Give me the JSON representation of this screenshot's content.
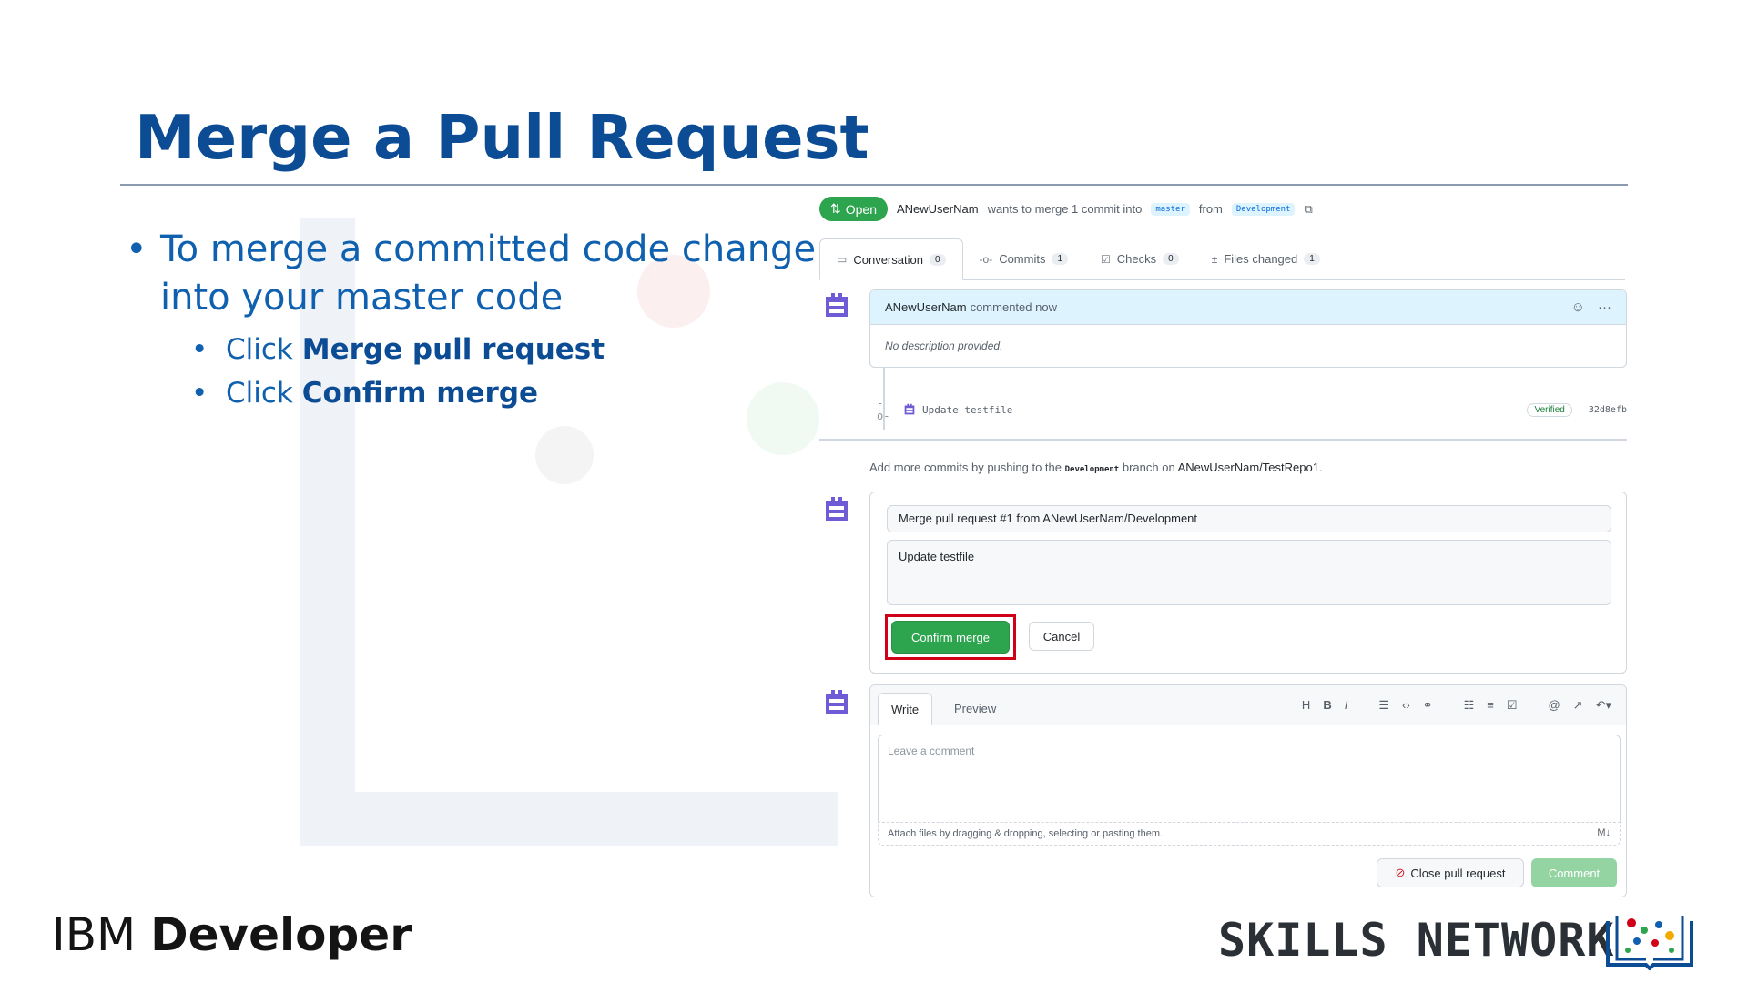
{
  "slide": {
    "title": "Merge a Pull Request",
    "bullet_main": "To merge a committed code change into your master code",
    "sub_bullets": [
      {
        "prefix": "Click ",
        "strong": "Merge pull request"
      },
      {
        "prefix": "Click ",
        "strong": "Confirm merge"
      }
    ]
  },
  "github": {
    "status_badge": "Open",
    "author": "ANewUserNam",
    "merge_text": "wants to merge 1 commit into",
    "base_branch": "master",
    "from_text": "from",
    "head_branch": "Development",
    "tabs": [
      {
        "label": "Conversation",
        "count": "0"
      },
      {
        "label": "Commits",
        "count": "1"
      },
      {
        "label": "Checks",
        "count": "0"
      },
      {
        "label": "Files changed",
        "count": "1"
      }
    ],
    "comment": {
      "author": "ANewUserNam",
      "meta": "commented now",
      "body": "No description provided."
    },
    "commit": {
      "message": "Update testfile",
      "badge": "Verified",
      "sha": "32d8efb"
    },
    "push_note": {
      "prefix": "Add more commits by pushing to the",
      "branch": "Development",
      "middle": "branch on",
      "repo": "ANewUserNam/TestRepo1",
      "suffix": "."
    },
    "merge_form": {
      "title_value": "Merge pull request #1 from ANewUserNam/Development",
      "body_value": "Update testfile",
      "confirm_label": "Confirm merge",
      "cancel_label": "Cancel"
    },
    "new_comment": {
      "tab_write": "Write",
      "tab_preview": "Preview",
      "placeholder": "Leave a comment",
      "attach_note": "Attach files by dragging & dropping, selecting or pasting them.",
      "close_label": "Close pull request",
      "comment_label": "Comment"
    }
  },
  "branding": {
    "ibm_light": "IBM",
    "ibm_bold": "Developer",
    "skills": "SKILLS NETWORK"
  },
  "colors": {
    "title_blue": "#0b4c95",
    "bullet_blue": "#1060b0",
    "github_green": "#2da44e",
    "highlight_red": "#d10019"
  }
}
